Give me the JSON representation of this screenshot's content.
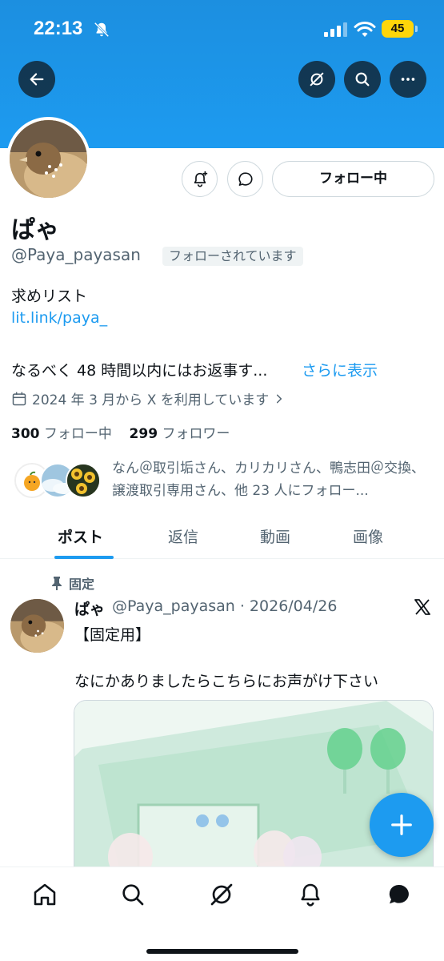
{
  "status_bar": {
    "time": "22:13",
    "battery": "45"
  },
  "profile": {
    "display_name": "ぱゃ",
    "handle": "@Paya_payasan",
    "follows_you": "フォローされています",
    "bio_line1": "求めリスト",
    "bio_link": "lit.link/paya_",
    "bio_line2": "なるべく 48 時間以内にはお返事す...",
    "show_more": "さらに表示",
    "joined": "2024 年 3 月から X を利用しています",
    "following_count": "300",
    "following_label": "フォロー中",
    "followers_count": "299",
    "followers_label": "フォロワー",
    "followed_by_text": "なん＠取引垢さん、カリカリさん、鴨志田＠交換、譲渡取引専用さん、他 23 人にフォロー..."
  },
  "actions": {
    "follow_button": "フォロー中"
  },
  "tabs": [
    {
      "label": "ポスト"
    },
    {
      "label": "返信"
    },
    {
      "label": "動画"
    },
    {
      "label": "画像"
    }
  ],
  "pinned_post": {
    "pinned_label": "固定",
    "author": "ぱゃ",
    "meta": "@Paya_payasan · 2026/04/26",
    "text_line1": "【固定用】",
    "text_line2": "なにかありましたらこちらにお声がけ下さい"
  },
  "colors": {
    "accent": "#1d9bf0",
    "text": "#0f1419",
    "muted": "#536471"
  },
  "icons": [
    "back-icon",
    "grok-icon",
    "search-icon",
    "more-icon",
    "bell-plus-icon",
    "message-icon",
    "calendar-icon",
    "pin-icon",
    "x-logo-icon",
    "compose-icon",
    "home-icon",
    "notifications-icon",
    "messages-icon"
  ]
}
